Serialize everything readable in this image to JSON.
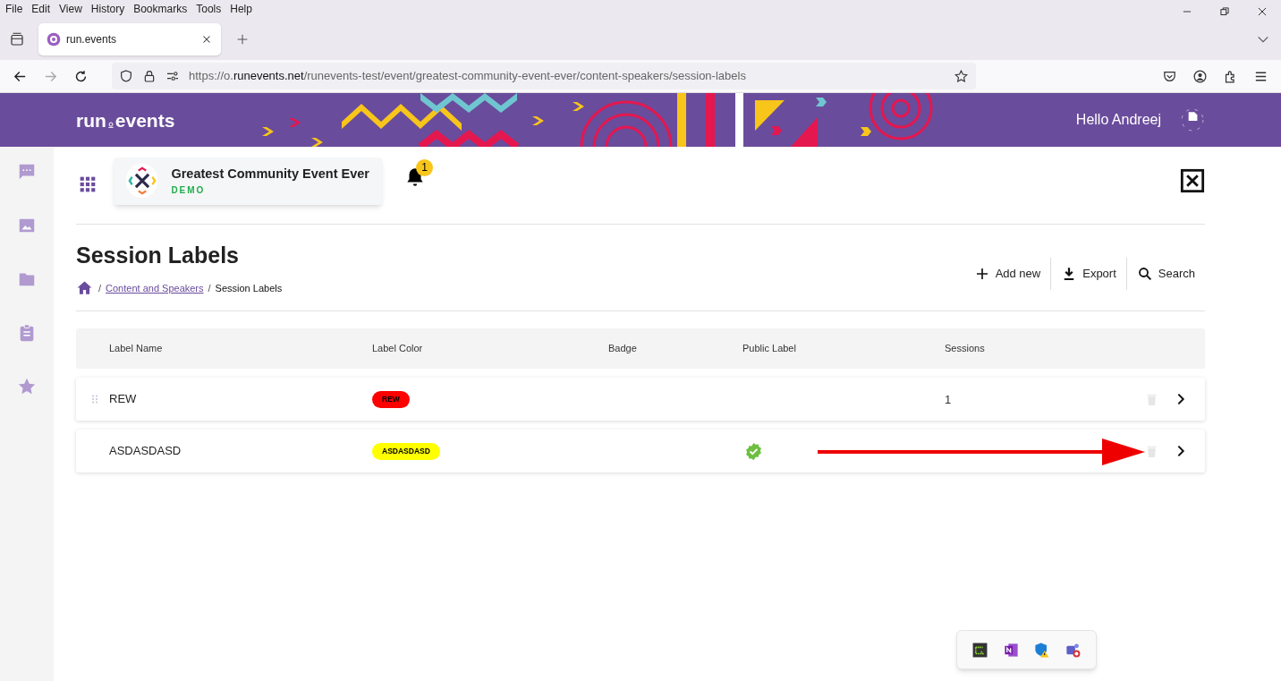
{
  "menu_bar": [
    "File",
    "Edit",
    "View",
    "History",
    "Bookmarks",
    "Tools",
    "Help"
  ],
  "browser": {
    "tab_title": "run.events",
    "url": {
      "prefix": "https://o.",
      "host": "runevents.net",
      "path": "/runevents-test/event/greatest-community-event-ever/content-speakers/session-labels"
    }
  },
  "header": {
    "logo": [
      "run",
      "events"
    ],
    "greeting": "Hello Andreej"
  },
  "sidebar": {
    "items": [
      {
        "kind": "chat"
      },
      {
        "kind": "image"
      },
      {
        "kind": "folder"
      },
      {
        "kind": "clipboard"
      },
      {
        "kind": "star"
      }
    ]
  },
  "event": {
    "name": "Greatest Community Event Ever",
    "badge": "DEMO",
    "notifications": "1"
  },
  "page": {
    "title": "Session Labels",
    "breadcrumb": [
      "Content and Speakers",
      "Session Labels"
    ],
    "separator": "/"
  },
  "actions": [
    {
      "kind": "add",
      "label": "Add new"
    },
    {
      "kind": "export",
      "label": "Export"
    },
    {
      "kind": "search",
      "label": "Search"
    }
  ],
  "table": {
    "columns": [
      "Label Name",
      "Label Color",
      "Badge",
      "Public Label",
      "Sessions"
    ],
    "rows": [
      {
        "name": "REW",
        "label": "REW",
        "color": "#ff0000",
        "public": false,
        "sessions": "1",
        "drag_handle": true
      },
      {
        "name": "ASDASDASD",
        "label": "ASDASDASD",
        "color": "#ffff00",
        "public": true,
        "drag_handle": false
      }
    ]
  },
  "annotation": {
    "kind": "arrow"
  },
  "tray": [
    {
      "kind": "terminal"
    },
    {
      "kind": "notes"
    },
    {
      "kind": "shield"
    },
    {
      "kind": "teams"
    }
  ]
}
